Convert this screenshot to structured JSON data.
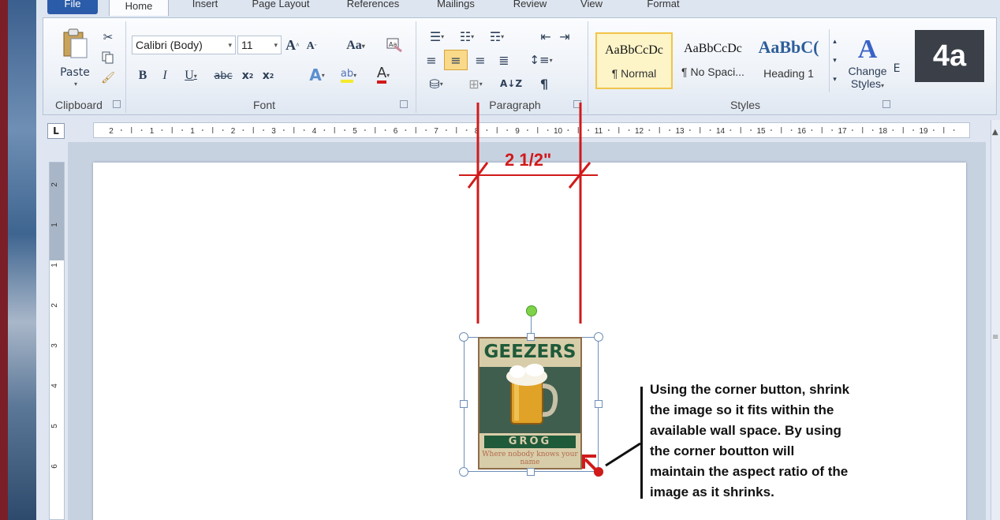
{
  "tabs": [
    {
      "label": "File"
    },
    {
      "label": "Home"
    },
    {
      "label": "Insert"
    },
    {
      "label": "Page Layout"
    },
    {
      "label": "References"
    },
    {
      "label": "Mailings"
    },
    {
      "label": "Review"
    },
    {
      "label": "View"
    },
    {
      "label": "Format"
    }
  ],
  "clipboard": {
    "paste_label": "Paste",
    "group_label": "Clipboard"
  },
  "font": {
    "family": "Calibri (Body)",
    "size": "11",
    "group_label": "Font",
    "change_case": "Aa"
  },
  "paragraph": {
    "group_label": "Paragraph"
  },
  "styles": {
    "group_label": "Styles",
    "items": [
      {
        "preview": "AaBbCcDc",
        "name": "¶ Normal"
      },
      {
        "preview": "AaBbCcDc",
        "name": "¶ No Spaci..."
      },
      {
        "preview": "AaBbC(",
        "name": "Heading 1"
      }
    ],
    "change_styles_line1": "Change",
    "change_styles_line2": "Styles",
    "editing_partial": "E"
  },
  "badge": "4a",
  "ruler": {
    "h_numbers": [
      "2",
      "1",
      "1",
      "2",
      "3",
      "4",
      "5",
      "6",
      "7",
      "8",
      "9",
      "10",
      "11",
      "12",
      "13",
      "14",
      "15",
      "16",
      "17",
      "18",
      "19"
    ],
    "v_numbers": [
      "2",
      "1",
      "1",
      "2",
      "3",
      "4",
      "5",
      "6"
    ]
  },
  "poster": {
    "title": "GEEZERS",
    "brand": "GROG",
    "tagline": "Where nobody knows your name"
  },
  "annotation": {
    "dimension": "2 1/2\"",
    "callout": "Using the corner button, shrink\nthe image so it fits within the\navailable wall space. By using\nthe corner boutton will\nmaintain the aspect ratio of the\nimage as it shrinks."
  },
  "colors": {
    "annotation_red": "#d11a1a",
    "selected_style": "#f0c54a",
    "file_tab": "#2b5ca9"
  }
}
